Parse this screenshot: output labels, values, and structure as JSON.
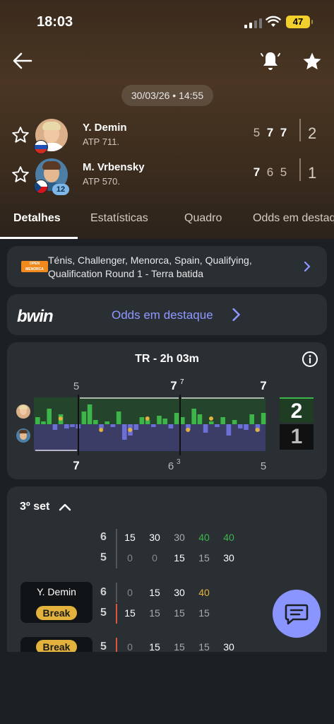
{
  "status_bar": {
    "time": "18:03",
    "battery": "47"
  },
  "match": {
    "datetime": "30/03/26 • 14:55"
  },
  "players": [
    {
      "name": "Y. Demin",
      "rank": "ATP 711.",
      "sets": [
        "5",
        "7",
        "7"
      ],
      "set_bold": [
        false,
        true,
        true
      ],
      "total": "2",
      "seed": ""
    },
    {
      "name": "M. Vrbensky",
      "rank": "ATP 570.",
      "sets": [
        "7",
        "6",
        "5"
      ],
      "set_bold": [
        true,
        false,
        false
      ],
      "total": "1",
      "seed": "12"
    }
  ],
  "tabs": [
    {
      "label": "Detalhes",
      "active": true
    },
    {
      "label": "Estatísticas",
      "active": false
    },
    {
      "label": "Quadro",
      "active": false
    },
    {
      "label": "Odds em destaque",
      "active": false
    }
  ],
  "tournament": {
    "logo_text": "OPEN MENORCA",
    "line1": "Ténis, Challenger, Menorca, Spain, Qualifying,",
    "line2": "Qualification Round 1 - Terra batida"
  },
  "odds_banner": {
    "brand": "bwin",
    "link_label": "Odds em destaque"
  },
  "momentum": {
    "title": "TR - 2h 03m",
    "top_scores": [
      {
        "score": "5",
        "tb": ""
      },
      {
        "score": "7",
        "tb": "7"
      },
      {
        "score": "7",
        "tb": ""
      }
    ],
    "bottom_scores": [
      {
        "score": "7",
        "tb": ""
      },
      {
        "score": "6",
        "tb": "3"
      },
      {
        "score": "5",
        "tb": ""
      }
    ],
    "set_score_top": "2",
    "set_score_bottom": "1",
    "colors": {
      "player1": "#3db54a",
      "player2": "#6b6fd6",
      "top_bg": "#24452b",
      "bottom_bg": "#3b3d66",
      "break_dot": "#e3b23c"
    }
  },
  "set3": {
    "title": "3º set",
    "game_rows": [
      {
        "games_top": "6",
        "games_bottom": "5",
        "top_points": [
          "15",
          "30",
          "30",
          "40",
          "40"
        ],
        "bottom_points": [
          "0",
          "0",
          "15",
          "15",
          "30"
        ]
      },
      {
        "player_label": "Y. Demin",
        "badge": "Break",
        "games_top": "6",
        "games_bottom": "5",
        "top_points": [
          "0",
          "15",
          "30",
          "40"
        ],
        "bottom_points": [
          "15",
          "15",
          "15",
          "15"
        ]
      },
      {
        "badge": "Break",
        "games": "5",
        "points": [
          "0",
          "15",
          "15",
          "15",
          "30"
        ]
      }
    ]
  }
}
